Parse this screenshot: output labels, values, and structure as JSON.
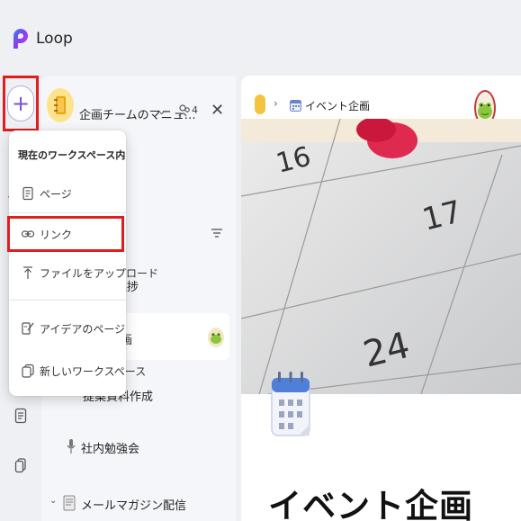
{
  "app": {
    "title": "Loop"
  },
  "workspace": {
    "title": "企画チームのマニュ…",
    "member_count": "4"
  },
  "breadcrumb": {
    "page": "イベント企画"
  },
  "new_menu": {
    "heading": "現在のワークスペース内",
    "items": [
      {
        "label": "ページ",
        "icon": "page-icon"
      },
      {
        "label": "リンク",
        "icon": "link-icon"
      },
      {
        "label": "ファイルをアップロード",
        "icon": "upload-icon"
      },
      {
        "label": "アイデアのページ",
        "icon": "idea-pen-icon"
      },
      {
        "label": "新しいワークスペース",
        "icon": "workspace-icon"
      }
    ]
  },
  "tree": {
    "items": [
      {
        "label": "進捗"
      },
      {
        "label": "提案資料作成"
      },
      {
        "label": "社内勉強会"
      },
      {
        "label": "メールマガジン配信"
      }
    ]
  },
  "page": {
    "title": "イベント企画",
    "cover_numbers": [
      "16",
      "17",
      "24"
    ]
  },
  "colors": {
    "accent": "#7b4fd6",
    "highlight": "#e01e1e",
    "workspace_yellow": "#f6c33f"
  }
}
